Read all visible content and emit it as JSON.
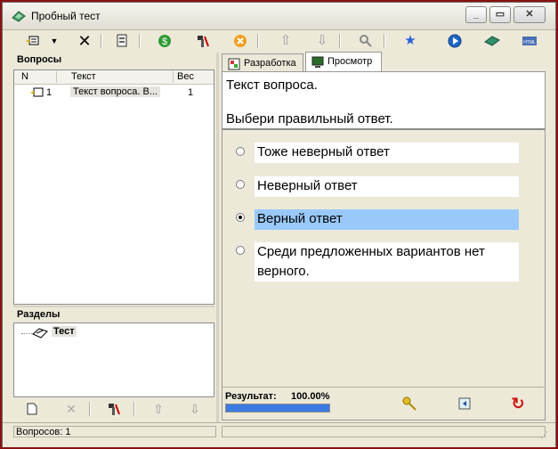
{
  "window": {
    "title": "Пробный тест"
  },
  "toolbar": {
    "icons": [
      "add-question-icon",
      "dropdown-arrow-icon",
      "delete-icon",
      "properties-icon",
      "money-icon",
      "tools-icon",
      "cancel-icon",
      "arrow-up-icon",
      "arrow-down-icon",
      "search-icon",
      "star-icon",
      "play-icon",
      "book-icon",
      "html-icon"
    ]
  },
  "questions_panel": {
    "title": "Вопросы",
    "columns": {
      "n": "N",
      "text": "Текст",
      "weight": "Вес"
    },
    "rows": [
      {
        "n": "1",
        "text": "Текст вопроса. В...",
        "weight": "1"
      }
    ]
  },
  "sections_panel": {
    "title": "Разделы",
    "tree": [
      {
        "label": "Тест"
      }
    ]
  },
  "tabs": [
    {
      "label": "Разработка",
      "active": false
    },
    {
      "label": "Просмотр",
      "active": true
    }
  ],
  "preview": {
    "question_text": "Текст вопроса.",
    "instruction": "Выбери правильный ответ.",
    "options": [
      {
        "text": "Тоже неверный ответ",
        "selected": false
      },
      {
        "text": "Неверный ответ",
        "selected": false
      },
      {
        "text": "Верный ответ",
        "selected": true
      },
      {
        "text": "Среди предложенных вариантов нет",
        "text2": "верного.",
        "selected": false
      }
    ],
    "result_label": "Результат:",
    "result_value": "100.00%",
    "progress": 1.0
  },
  "status": {
    "questions_count": "Вопросов: 1"
  },
  "colors": {
    "selected_option": "#99c9fb",
    "progress": "#3a7be0",
    "window_bg": "#ece9d8"
  }
}
